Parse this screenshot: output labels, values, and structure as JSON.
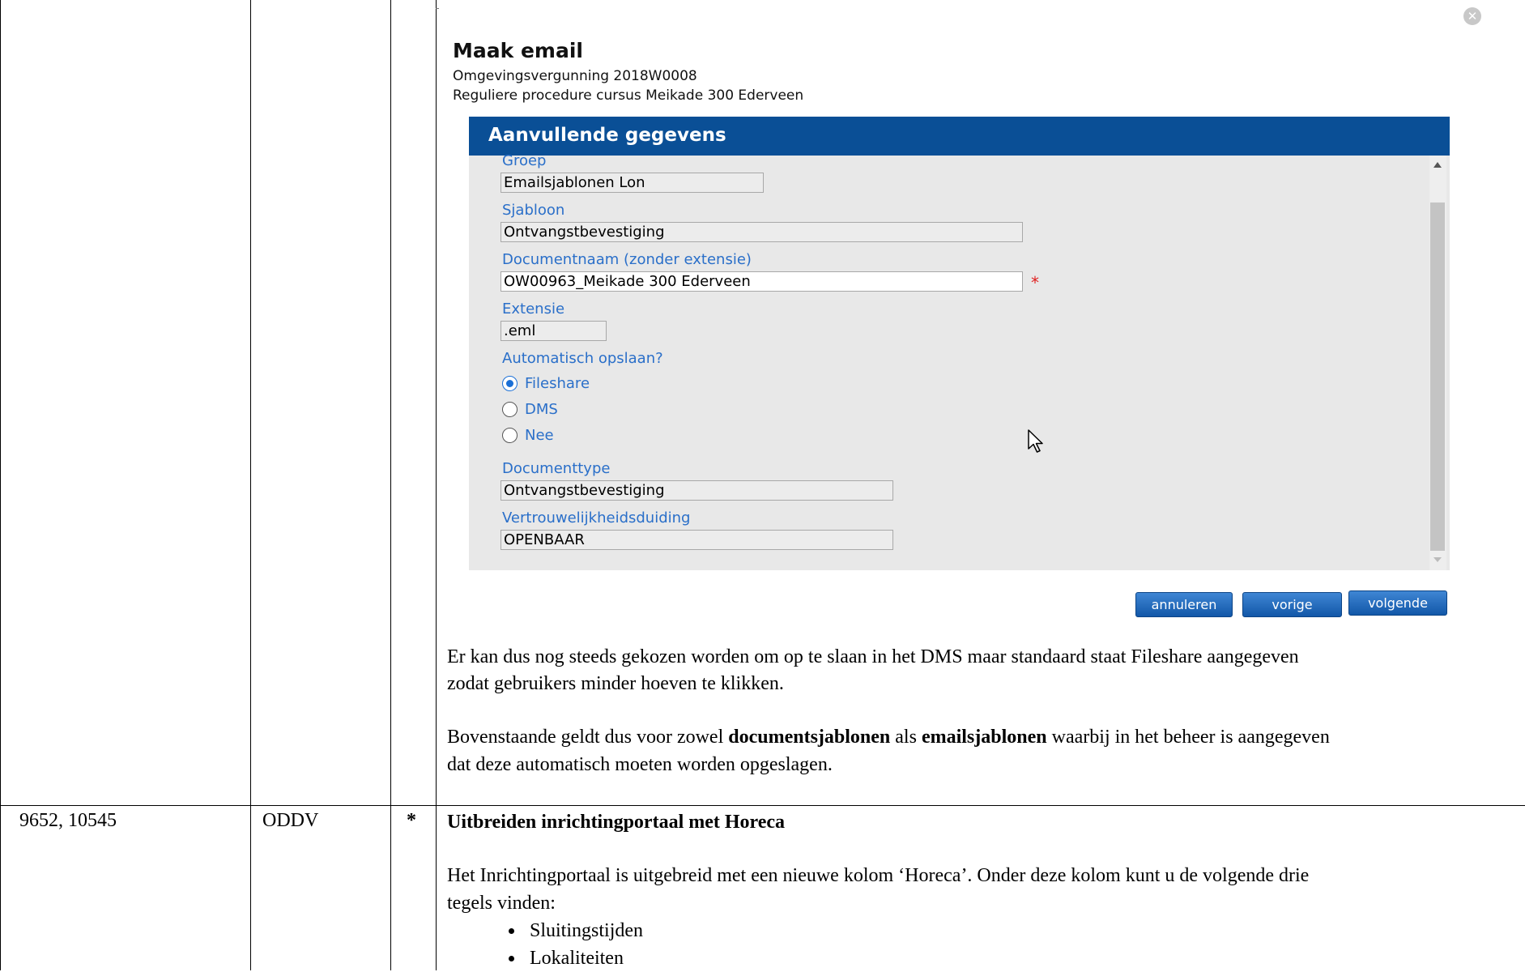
{
  "dialog": {
    "title": "Maak email",
    "subtitle_line1": "Omgevingsvergunning 2018W0008",
    "subtitle_line2": "Reguliere procedure cursus Meikade 300 Ederveen",
    "section_header": "Aanvullende gegevens",
    "fields": {
      "groep_label": "Groep",
      "groep_value": "Emailsjablonen Lon",
      "sjabloon_label": "Sjabloon",
      "sjabloon_value": "Ontvangstbevestiging",
      "documentnaam_label": "Documentnaam (zonder extensie)",
      "documentnaam_value": "OW00963_Meikade 300 Ederveen",
      "required_marker": "*",
      "extensie_label": "Extensie",
      "extensie_value": ".eml",
      "auto_save_label": "Automatisch opslaan?",
      "auto_save_options": [
        "Fileshare",
        "DMS",
        "Nee"
      ],
      "auto_save_selected": "Fileshare",
      "documenttype_label": "Documenttype",
      "documenttype_value": "Ontvangstbevestiging",
      "vertrouwelijkheid_label": "Vertrouwelijkheidsduiding",
      "vertrouwelijkheid_value": "OPENBAAR"
    },
    "buttons": {
      "cancel": "annuleren",
      "previous": "vorige",
      "next": "volgende"
    }
  },
  "text": {
    "para1_line1": "Er kan dus nog steeds gekozen worden om op te slaan in het DMS maar standaard staat Fileshare aangegeven",
    "para1_line2": "zodat gebruikers minder hoeven te klikken.",
    "para2_pre": "Bovenstaande geldt dus voor zowel ",
    "para2_bold1": "documentsjablonen",
    "para2_mid": " als ",
    "para2_bold2": "emailsjablonen",
    "para2_post": " waarbij in het beheer is aangegeven",
    "para2_line2": "dat deze automatisch moeten worden opgeslagen."
  },
  "row2": {
    "ids": "9652, 10545",
    "org": "ODDV",
    "marker": "*",
    "heading": "Uitbreiden inrichtingportaal met Horeca",
    "body_line1": "Het Inrichtingportaal is uitgebreid met een nieuwe kolom ‘Horeca’. Onder deze kolom kunt u de volgende drie",
    "body_line2": "tegels vinden:",
    "bullets": [
      "Sluitingstijden",
      "Lokaliteiten"
    ]
  }
}
